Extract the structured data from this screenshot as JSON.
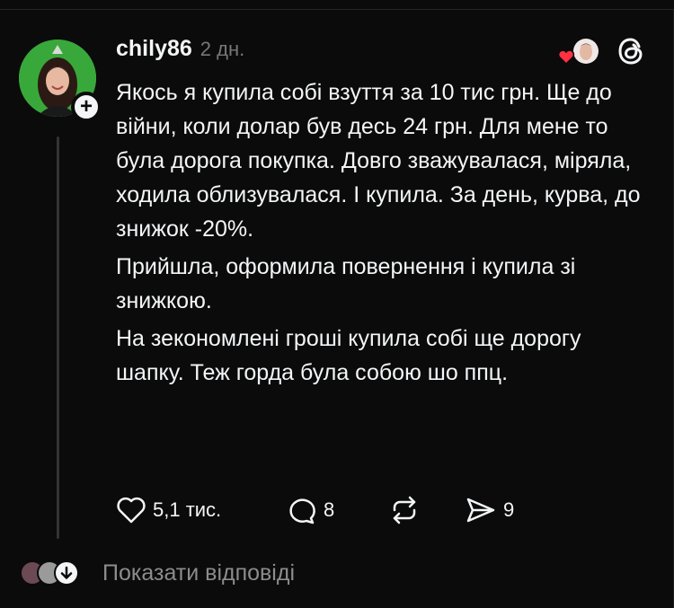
{
  "post": {
    "username": "chily86",
    "time": "2 дн.",
    "paragraphs": [
      "Якось я купила собі взуття за 10 тис грн. Ще до війни, коли долар був десь 24 грн. Для мене то була дорога покупка. Довго зважувалася, міряла, ходила облизувалася. І купила. За день, курва, до знижок -20%.",
      "Прийшла, оформила повернення і купила зі знижкою.",
      "На зекономлені гроші купила собі ще дорогу шапку. Теж горда була собою шо ппц."
    ]
  },
  "actions": {
    "likes": "5,1 тис.",
    "comments": "8",
    "reposts": "",
    "shares": "9"
  },
  "footer": {
    "show_replies": "Показати відповіді"
  },
  "icons": {
    "like": "heart-outline-icon",
    "comment": "speech-bubble-icon",
    "repost": "repost-arrows-icon",
    "share": "send-arrow-icon",
    "threads": "threads-logo-icon",
    "liked_by_author": "red-heart-icon"
  },
  "colors": {
    "background": "#0b0b0b",
    "text": "#f3f5f7",
    "muted": "#777777",
    "heart": "#ff3040",
    "avatar_bg": "#38a83a"
  }
}
